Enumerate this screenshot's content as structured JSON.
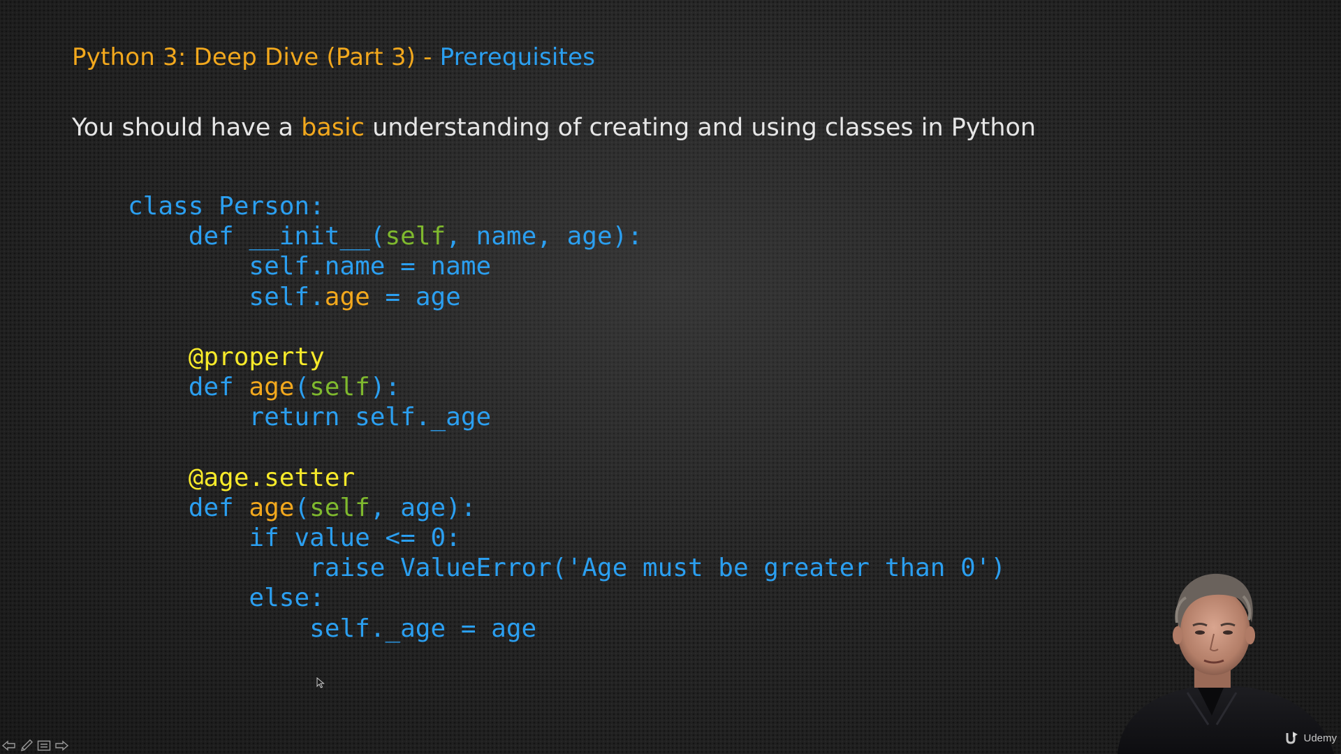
{
  "title": {
    "main": "Python 3: Deep Dive (Part 3)",
    "separator": " - ",
    "sub": "Prerequisites"
  },
  "intro": {
    "before": "You should have a ",
    "highlight": "basic",
    "after": " understanding of creating and using classes in Python"
  },
  "code": {
    "line1": {
      "kw": "class ",
      "name": "Person:"
    },
    "line2": {
      "indent": "    ",
      "kw": "def ",
      "fn": "__init__(",
      "p1": "self",
      "s1": ", ",
      "p2": "name",
      "s2": ", ",
      "p3": "age",
      "end": "):"
    },
    "line3": {
      "indent": "        ",
      "text": "self.name = name"
    },
    "line4": {
      "indent": "        ",
      "pre": "self.",
      "attr": "age",
      "post": " = age"
    },
    "line6": {
      "indent": "    ",
      "deco": "@property"
    },
    "line7": {
      "indent": "    ",
      "kw": "def ",
      "fn": "age",
      "open": "(",
      "p1": "self",
      "end": "):"
    },
    "line8": {
      "indent": "        ",
      "text": "return self._age"
    },
    "line10": {
      "indent": "    ",
      "deco": "@age.setter"
    },
    "line11": {
      "indent": "    ",
      "kw": "def ",
      "fn": "age",
      "open": "(",
      "p1": "self",
      "s1": ", ",
      "p2": "age",
      "end": "):"
    },
    "line12": {
      "indent": "        ",
      "text": "if value <= 0:"
    },
    "line13": {
      "indent": "            ",
      "text": "raise ValueError('Age must be greater than 0')"
    },
    "line14": {
      "indent": "        ",
      "text": "else:"
    },
    "line15": {
      "indent": "            ",
      "text": "self._age = age"
    }
  },
  "watermark": {
    "brand": "Udemy"
  },
  "colors": {
    "orange": "#f2a81d",
    "blue": "#2b9ff0",
    "green": "#7fb92e",
    "yellow": "#f7ea2a",
    "text": "#e6e6e6"
  },
  "icons": {
    "controls": [
      "previous-slide-icon",
      "pen-icon",
      "slide-menu-icon",
      "next-slide-icon"
    ],
    "cursor": "mouse-cursor-icon",
    "brand": "udemy-logo-icon"
  }
}
